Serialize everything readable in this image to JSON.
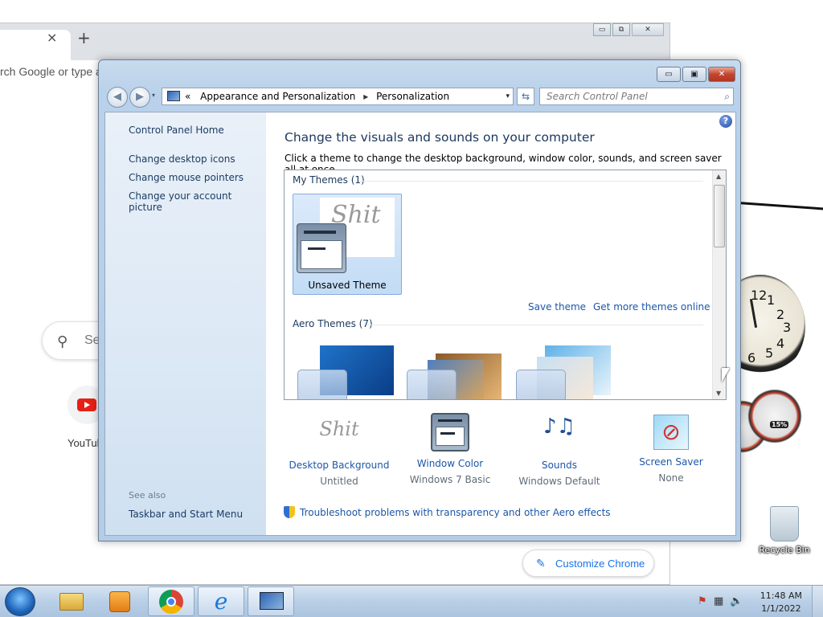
{
  "chrome": {
    "omnibox_placeholder": "rch Google or type a",
    "search_placeholder": "Se",
    "shortcut_label": "YouTub",
    "customize_label": "Customize Chrome",
    "tab_close": "×",
    "new_tab": "+",
    "win_min": "▭",
    "win_max": "⧉",
    "win_close": "✕"
  },
  "desktop": {
    "recycle_bin_label": "Recycle Bin",
    "cpu_percent": "15%",
    "clock_numbers": [
      "12",
      "1",
      "2",
      "3",
      "4",
      "5",
      "6"
    ]
  },
  "window": {
    "min": "▭",
    "max": "▣",
    "close": "✕"
  },
  "address": {
    "prefix": "«",
    "crumb1": "Appearance and Personalization",
    "separator": "▸",
    "crumb2": "Personalization",
    "dropdown": "▾",
    "refresh": "⇆"
  },
  "search": {
    "placeholder": "Search Control Panel",
    "icon": "⌕"
  },
  "sidebar": {
    "home": "Control Panel Home",
    "links": [
      "Change desktop icons",
      "Change mouse pointers",
      "Change your account picture"
    ],
    "see_also": "See also",
    "see_also_links": [
      "Taskbar and Start Menu"
    ]
  },
  "main": {
    "help_icon": "?",
    "title": "Change the visuals and sounds on your computer",
    "description": "Click a theme to change the desktop background, window color, sounds, and screen saver all at once.",
    "my_themes_header": "My Themes (1)",
    "unsaved_theme_label": "Unsaved Theme",
    "unsaved_theme_bg_text": "Shit",
    "save_theme": "Save theme",
    "get_more_themes": "Get more themes online",
    "aero_themes_header": "Aero Themes (7)",
    "scroll_up": "▲",
    "scroll_down": "▼"
  },
  "options": [
    {
      "name": "Desktop Background",
      "value": "Untitled",
      "icon": "handwriting-icon",
      "icon_text": "Shit"
    },
    {
      "name": "Window Color",
      "value": "Windows 7 Basic",
      "icon": "window-color-icon"
    },
    {
      "name": "Sounds",
      "value": "Windows Default",
      "icon": "sounds-icon",
      "icon_text": "♪♫"
    },
    {
      "name": "Screen Saver",
      "value": "None",
      "icon": "screen-saver-icon",
      "icon_text": "⊘"
    }
  ],
  "troubleshoot_link": "Troubleshoot problems with transparency and other Aero effects",
  "taskbar": {
    "time": "11:48 AM",
    "date": "1/1/2022",
    "tray_icons": [
      "flag-icon",
      "network-icon",
      "volume-icon"
    ]
  },
  "colors": {
    "link": "#1b57a8",
    "title": "#1e3960",
    "sidebar_bg": "#dbe8f5",
    "close_button": "#c4452c"
  }
}
